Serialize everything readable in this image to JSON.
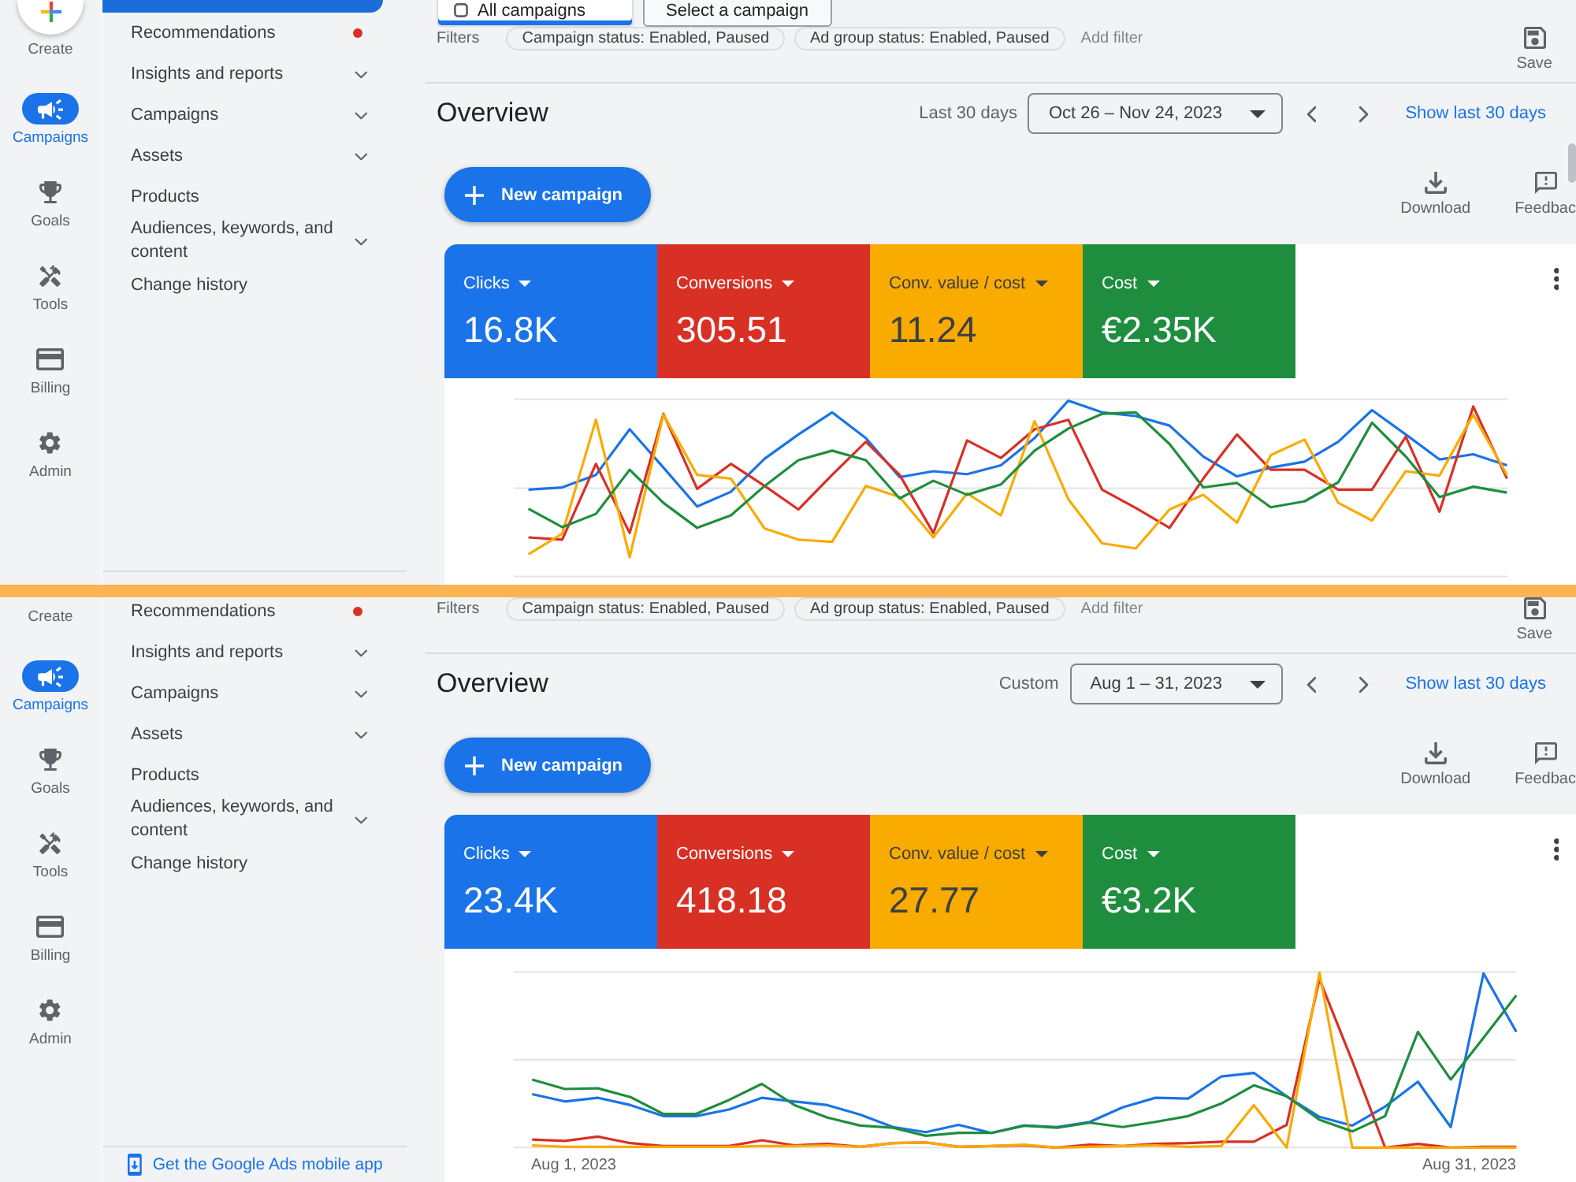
{
  "panels": [
    {
      "rail": {
        "create": {
          "label": "Create"
        },
        "items": [
          {
            "label": "Campaigns",
            "selected": true
          },
          {
            "label": "Goals",
            "selected": false
          },
          {
            "label": "Tools",
            "selected": false
          },
          {
            "label": "Billing",
            "selected": false
          },
          {
            "label": "Admin",
            "selected": false
          }
        ]
      },
      "nav": {
        "items": [
          {
            "label": "Recommendations",
            "notification": true,
            "expandable": false
          },
          {
            "label": "Insights and reports",
            "notification": false,
            "expandable": true
          },
          {
            "label": "Campaigns",
            "notification": false,
            "expandable": true
          },
          {
            "label": "Assets",
            "notification": false,
            "expandable": true
          },
          {
            "label": "Products",
            "notification": false,
            "expandable": false
          },
          {
            "label": "Audiences, keywords, and content",
            "notification": false,
            "expandable": true
          },
          {
            "label": "Change history",
            "notification": false,
            "expandable": false
          }
        ]
      },
      "tabs": [
        {
          "label": "All campaigns",
          "selected": true
        },
        {
          "label": "Select a campaign",
          "selected": false
        }
      ],
      "filters": {
        "label": "Filters",
        "chips": [
          "Campaign status: Enabled, Paused",
          "Ad group status: Enabled, Paused"
        ],
        "add_filter": "Add filter"
      },
      "save": "Save",
      "overview": {
        "title": "Overview",
        "date_label": "Last 30 days",
        "date_range": "Oct 26 – Nov 24, 2023",
        "show_last": "Show last 30 days"
      },
      "actions": {
        "new_campaign": "New campaign",
        "tools": [
          "Download",
          "Feedbac"
        ]
      },
      "metrics": [
        {
          "label": "Clicks",
          "value": "16.8K",
          "color": "#1a73e8"
        },
        {
          "label": "Conversions",
          "value": "305.51",
          "color": "#d93025"
        },
        {
          "label": "Conv. value / cost",
          "value": "11.24",
          "color": "#f9ab00"
        },
        {
          "label": "Cost",
          "value": "€2.35K",
          "color": "#1e8e3e"
        }
      ]
    },
    {
      "rail": {
        "create": {
          "label": "Create"
        },
        "items": [
          {
            "label": "Campaigns",
            "selected": true
          },
          {
            "label": "Goals",
            "selected": false
          },
          {
            "label": "Tools",
            "selected": false
          },
          {
            "label": "Billing",
            "selected": false
          },
          {
            "label": "Admin",
            "selected": false
          }
        ]
      },
      "nav": {
        "items": [
          {
            "label": "Recommendations",
            "notification": true,
            "expandable": false
          },
          {
            "label": "Insights and reports",
            "notification": false,
            "expandable": true
          },
          {
            "label": "Campaigns",
            "notification": false,
            "expandable": true
          },
          {
            "label": "Assets",
            "notification": false,
            "expandable": true
          },
          {
            "label": "Products",
            "notification": false,
            "expandable": false
          },
          {
            "label": "Audiences, keywords, and content",
            "notification": false,
            "expandable": true
          },
          {
            "label": "Change history",
            "notification": false,
            "expandable": false
          }
        ],
        "mobile_app_link": "Get the Google Ads mobile app"
      },
      "filters": {
        "label": "Filters",
        "chips": [
          "Campaign status: Enabled, Paused",
          "Ad group status: Enabled, Paused"
        ],
        "add_filter": "Add filter"
      },
      "save": "Save",
      "overview": {
        "title": "Overview",
        "date_label": "Custom",
        "date_range": "Aug 1 – 31, 2023",
        "show_last": "Show last 30 days"
      },
      "actions": {
        "new_campaign": "New campaign",
        "tools": [
          "Download",
          "Feedbac"
        ]
      },
      "metrics": [
        {
          "label": "Clicks",
          "value": "23.4K",
          "color": "#1a73e8"
        },
        {
          "label": "Conversions",
          "value": "418.18",
          "color": "#d93025"
        },
        {
          "label": "Conv. value / cost",
          "value": "27.77",
          "color": "#f9ab00"
        },
        {
          "label": "Cost",
          "value": "€3.2K",
          "color": "#1e8e3e"
        }
      ],
      "chart": {
        "axis_labels": [
          "Aug 1, 2023",
          "Aug 31, 2023"
        ]
      }
    }
  ]
}
